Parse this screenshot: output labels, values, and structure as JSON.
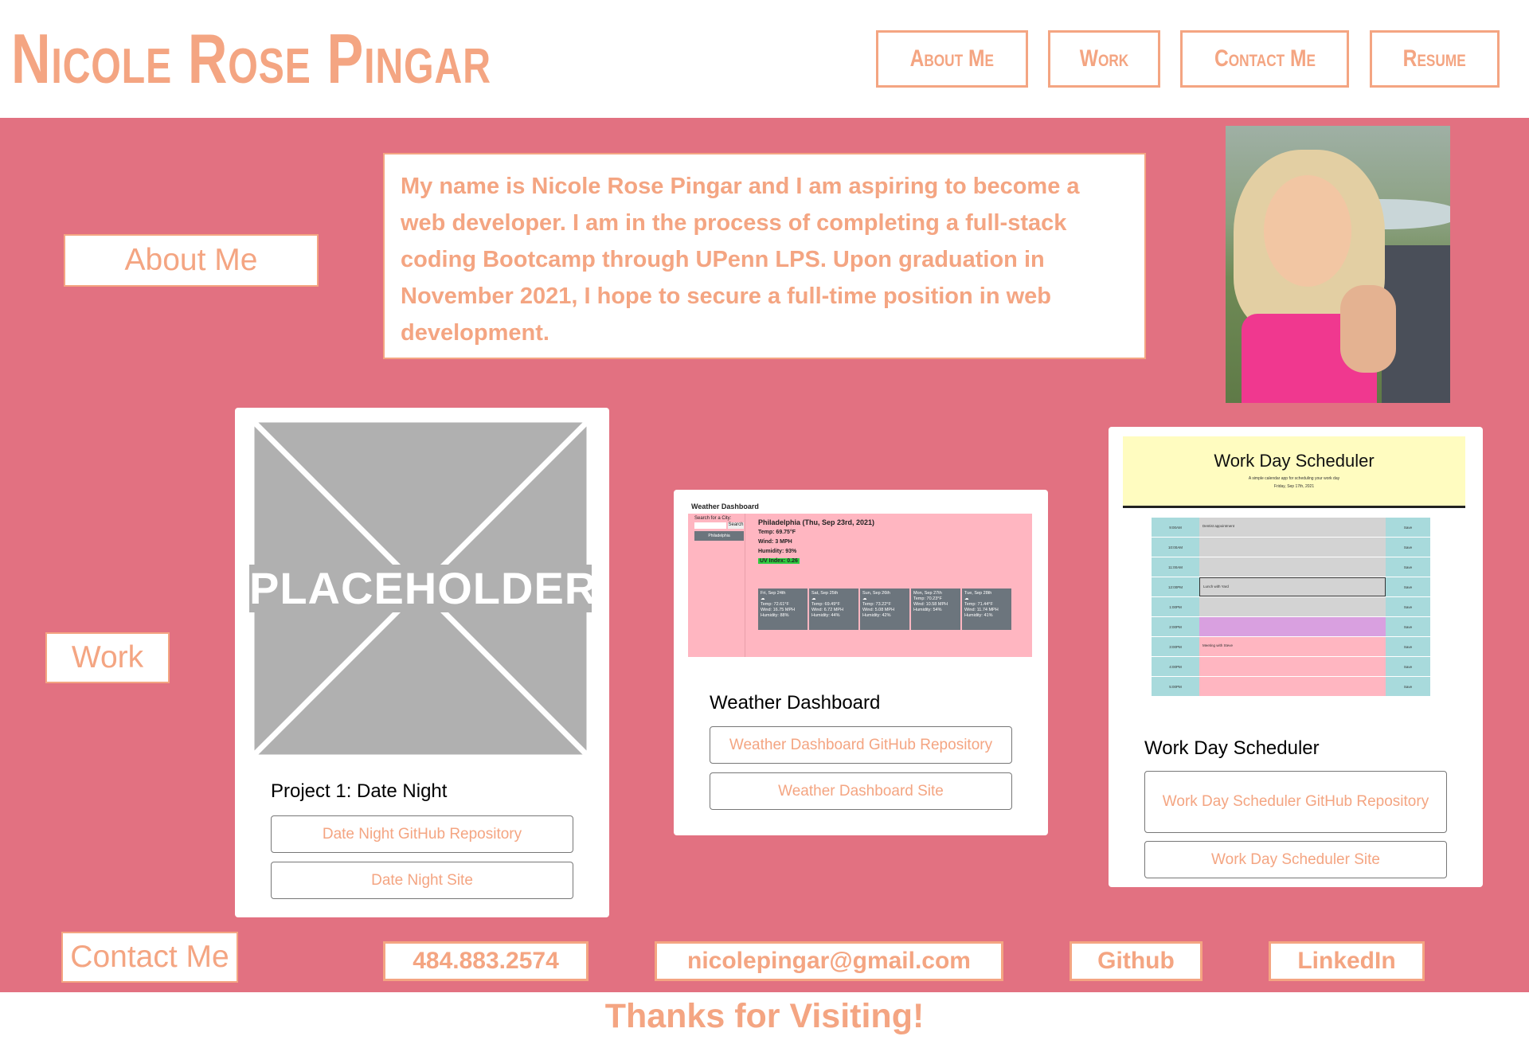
{
  "header": {
    "title": "Nicole Rose Pingar",
    "nav": [
      {
        "label": "About Me"
      },
      {
        "label": "Work"
      },
      {
        "label": "Contact Me"
      },
      {
        "label": "Resume"
      }
    ]
  },
  "about": {
    "label": "About Me",
    "text": "My name is Nicole Rose Pingar and I am aspiring to become a web developer. I am in the process of completing a full-stack coding Bootcamp through UPenn LPS. Upon graduation in November 2021, I hope to secure a full-time position in web development."
  },
  "work": {
    "label": "Work",
    "projects": [
      {
        "image_text": "PLACEHOLDER",
        "title": "Project 1: Date Night",
        "repo_label": "Date Night GitHub Repository",
        "site_label": "Date Night Site"
      },
      {
        "title": "Weather Dashboard",
        "repo_label": "Weather Dashboard GitHub Repository",
        "site_label": "Weather Dashboard Site",
        "screenshot": {
          "app_title": "Weather Dashboard",
          "search_label": "Search for a City:",
          "search_button": "Search",
          "history_city": "Philadelphia",
          "city_heading": "Philadelphia (Thu, Sep 23rd, 2021)",
          "temp": "Temp: 69.75°F",
          "wind": "Wind: 3 MPH",
          "humidity": "Humidity: 93%",
          "uv": "UV Index: 0.26",
          "forecast": [
            {
              "day": "Fri, Sep 24th",
              "temp": "Temp: 72.61°F",
              "wind": "Wind: 16.75 MPH",
              "humidity": "Humidity: 88%"
            },
            {
              "day": "Sat, Sep 25th",
              "temp": "Temp: 69.49°F",
              "wind": "Wind: 6.72 MPH",
              "humidity": "Humidity: 44%"
            },
            {
              "day": "Sun, Sep 26th",
              "temp": "Temp: 73.22°F",
              "wind": "Wind: 5.08 MPH",
              "humidity": "Humidity: 42%"
            },
            {
              "day": "Mon, Sep 27th",
              "temp": "Temp: 70.23°F",
              "wind": "Wind: 10.58 MPH",
              "humidity": "Humidity: 54%"
            },
            {
              "day": "Tue, Sep 28th",
              "temp": "Temp: 71.44°F",
              "wind": "Wind: 11.74 MPH",
              "humidity": "Humidity: 41%"
            }
          ]
        }
      },
      {
        "title": "Work Day Scheduler",
        "repo_label": "Work Day Scheduler GitHub Repository",
        "site_label": "Work Day Scheduler Site",
        "screenshot": {
          "app_title": "Work Day Scheduler",
          "subtitle": "A simple calendar app for scheduling your work day",
          "date": "Friday, Sep 17th, 2021",
          "save_label": "Save",
          "rows": [
            {
              "hour": "9:00AM",
              "text": "Dentist appointment",
              "state": "past"
            },
            {
              "hour": "10:00AM",
              "text": "",
              "state": "past"
            },
            {
              "hour": "11:00AM",
              "text": "",
              "state": "past"
            },
            {
              "hour": "12:00PM",
              "text": "Lunch with Yard",
              "state": "past"
            },
            {
              "hour": "1:00PM",
              "text": "",
              "state": "past"
            },
            {
              "hour": "2:00PM",
              "text": "",
              "state": "present"
            },
            {
              "hour": "3:00PM",
              "text": "Meeting with Steve",
              "state": "future"
            },
            {
              "hour": "4:00PM",
              "text": "",
              "state": "future"
            },
            {
              "hour": "5:00PM",
              "text": "",
              "state": "future"
            }
          ]
        }
      }
    ]
  },
  "contact": {
    "label": "Contact Me",
    "phone": "484.883.2574",
    "email": "nicolepingar@gmail.com",
    "github": "Github",
    "linkedin": "LinkedIn"
  },
  "footer": {
    "text": "Thanks for Visiting!"
  },
  "colors": {
    "accent": "#f4a582",
    "main_bg": "#e27181",
    "past": "#d3d3d3",
    "present": "#d9a0e0",
    "future": "#ffb6c1",
    "hour_col": "#a8dadc"
  }
}
